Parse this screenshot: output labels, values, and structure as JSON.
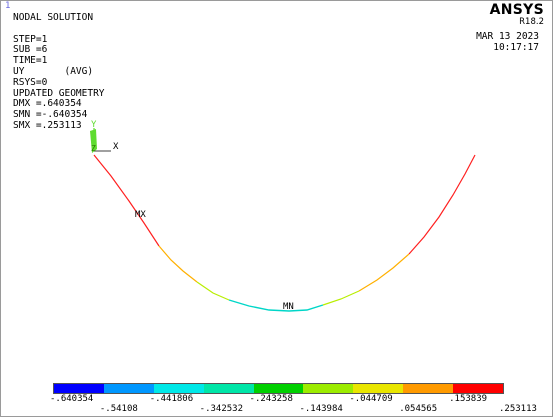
{
  "window_number": "1",
  "info_lines": [
    "NODAL SOLUTION",
    "",
    "STEP=1",
    "SUB =6",
    "TIME=1",
    "UY       (AVG)",
    "RSYS=0",
    "UPDATED GEOMETRY",
    "DMX =.640354",
    "SMN =-.640354",
    "SMX =.253113"
  ],
  "brand": {
    "name": "ANSYS",
    "release": "R18.2"
  },
  "stamp": {
    "date": "MAR 13 2023",
    "time": "10:17:17"
  },
  "triad": {
    "y_label": "Y",
    "x_label": "X",
    "z_label": "Z"
  },
  "markers": {
    "max_label": "MX",
    "min_label": "MN"
  },
  "legend": {
    "colors": [
      "#0000ff",
      "#0097ff",
      "#00e8e8",
      "#00e6a8",
      "#00d000",
      "#9cec00",
      "#e9e600",
      "#ff9a00",
      "#ff0000"
    ],
    "labels_top": [
      "-.640354",
      "-.441806",
      "-.243258",
      "-.044709",
      ".153839"
    ],
    "labels_bottom": [
      "-.54108",
      "-.342532",
      "-.143984",
      ".054565",
      ".253113"
    ]
  },
  "colors": {
    "background": "#ffffff",
    "triad": "#5fdc30"
  }
}
